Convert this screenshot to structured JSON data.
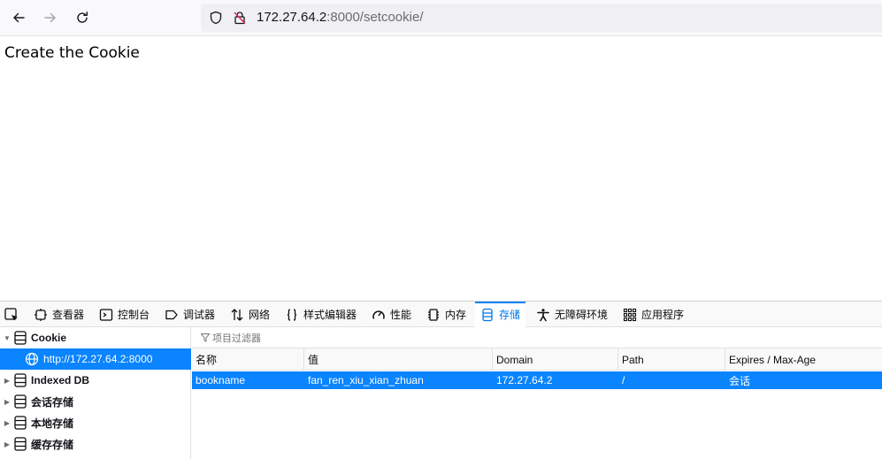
{
  "browser": {
    "url_host": "172.27.64.2",
    "url_rest": ":8000/setcookie/"
  },
  "page": {
    "heading": "Create the Cookie"
  },
  "devtools": {
    "tabs": [
      {
        "label": "查看器",
        "icon": "inspector-icon"
      },
      {
        "label": "控制台",
        "icon": "console-icon"
      },
      {
        "label": "调试器",
        "icon": "debugger-icon"
      },
      {
        "label": "网络",
        "icon": "network-icon"
      },
      {
        "label": "样式编辑器",
        "icon": "style-editor-icon"
      },
      {
        "label": "性能",
        "icon": "performance-icon"
      },
      {
        "label": "内存",
        "icon": "memory-icon"
      },
      {
        "label": "存储",
        "icon": "storage-icon",
        "active": true
      },
      {
        "label": "无障碍环境",
        "icon": "accessibility-icon"
      },
      {
        "label": "应用程序",
        "icon": "application-icon"
      }
    ],
    "tree": {
      "cookie": "Cookie",
      "cookie_host": "http://172.27.64.2:8000",
      "indexed_db": "Indexed DB",
      "session_storage": "会话存储",
      "local_storage": "本地存储",
      "cache_storage": "缓存存储"
    },
    "filter_placeholder": "项目过滤器",
    "columns": [
      "名称",
      "值",
      "Domain",
      "Path",
      "Expires / Max-Age"
    ],
    "rows": [
      [
        "bookname",
        "fan_ren_xiu_xian_zhuan",
        "172.27.64.2",
        "/",
        "会话"
      ]
    ],
    "accent_color": "#0a84ff"
  }
}
